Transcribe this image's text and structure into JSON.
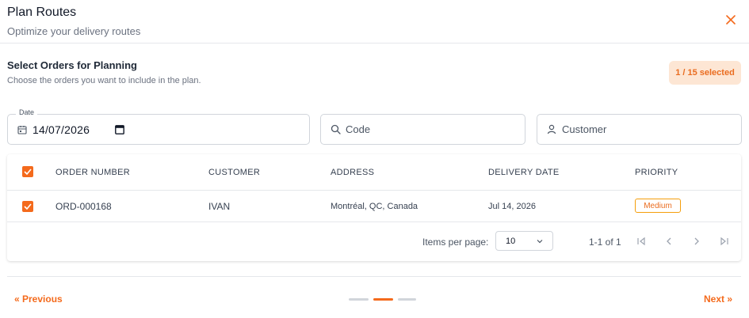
{
  "header": {
    "title": "Plan Routes",
    "subtitle": "Optimize your delivery routes"
  },
  "section": {
    "title": "Select Orders for Planning",
    "description": "Choose the orders you want to include in the plan.",
    "selected_badge": "1 / 15 selected"
  },
  "filters": {
    "date_label": "Date",
    "date_value": "14/07/2026",
    "code_placeholder": "Code",
    "customer_placeholder": "Customer"
  },
  "table": {
    "columns": [
      "ORDER NUMBER",
      "CUSTOMER",
      "ADDRESS",
      "DELIVERY DATE",
      "PRIORITY"
    ],
    "rows": [
      {
        "order_number": "ORD-000168",
        "customer": "IVAN",
        "address": "Montréal, QC, Canada",
        "delivery_date": "Jul 14, 2026",
        "priority": "Medium",
        "selected": true
      }
    ]
  },
  "paginator": {
    "items_per_page_label": "Items per page:",
    "items_per_page_value": "10",
    "range_label": "1-1 of 1"
  },
  "footer": {
    "previous_label": "« Previous",
    "next_label": "Next »",
    "steps_total": 3,
    "current_step": 2
  },
  "colors": {
    "accent": "#f46a1c",
    "badge_bg": "#fde6d4",
    "step_inactive": "#d1d5db"
  },
  "icons": {
    "close": "close-icon",
    "calendar": "calendar-icon",
    "search": "search-icon",
    "person": "person-icon",
    "first_page": "first-page-icon",
    "prev_page": "chevron-left-icon",
    "next_page": "chevron-right-icon",
    "last_page": "last-page-icon"
  }
}
